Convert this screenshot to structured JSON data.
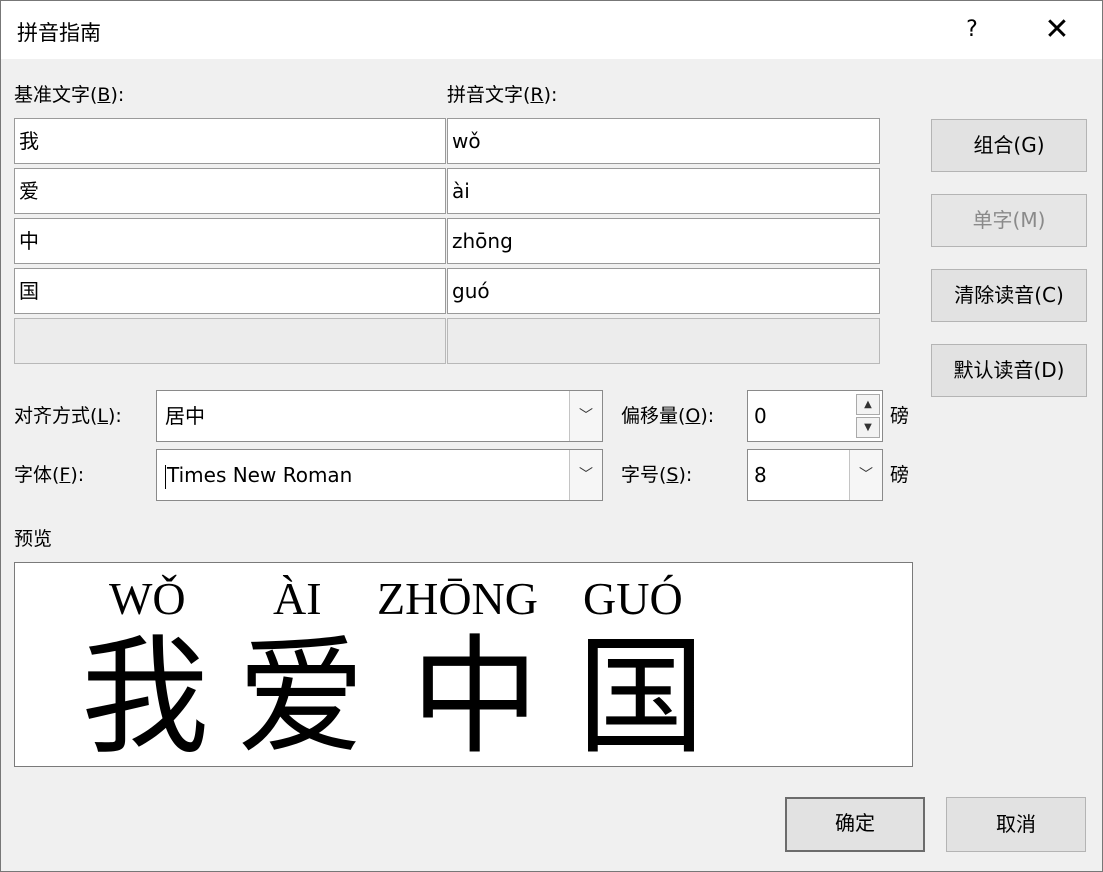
{
  "window": {
    "title": "拼音指南",
    "help_icon_glyph": "?",
    "close_icon_glyph": "✕"
  },
  "headers": {
    "base": {
      "text": "基准文字(",
      "acc": "B",
      "end": "):"
    },
    "pinyin": {
      "text": "拼音文字(",
      "acc": "R",
      "end": "):"
    }
  },
  "rows": [
    {
      "base": "我",
      "pinyin": "wǒ"
    },
    {
      "base": "爱",
      "pinyin": "ài"
    },
    {
      "base": "中",
      "pinyin": "zhōng"
    },
    {
      "base": "国",
      "pinyin": "guó"
    },
    {
      "base": "",
      "pinyin": ""
    }
  ],
  "side_buttons": {
    "group": "组合(G)",
    "single": "单字(M)",
    "clear": "清除读音(C)",
    "default": "默认读音(D)"
  },
  "alignment": {
    "label": {
      "text": "对齐方式(",
      "acc": "L",
      "end": "):"
    },
    "value": "居中"
  },
  "offset": {
    "label": {
      "text": "偏移量(",
      "acc": "O",
      "end": "):"
    },
    "value": "0",
    "unit": "磅"
  },
  "font": {
    "label": {
      "text": "字体(",
      "acc": "F",
      "end": "):"
    },
    "value": "Times New Roman"
  },
  "size": {
    "label": {
      "text": "字号(",
      "acc": "S",
      "end": "):"
    },
    "value": "8",
    "unit": "磅"
  },
  "preview": {
    "label": "预览",
    "items": [
      {
        "pinyin": "WǑ",
        "char": "我"
      },
      {
        "pinyin": "ÀI",
        "char": "爱"
      },
      {
        "pinyin": "ZHŌNG",
        "char": "中"
      },
      {
        "pinyin": "GUÓ",
        "char": "国"
      }
    ]
  },
  "footer": {
    "ok": "确定",
    "cancel": "取消"
  },
  "icons": {
    "dropdown": "chevron-down-icon",
    "spin_up": "spin-up-icon",
    "spin_down": "spin-down-icon"
  }
}
